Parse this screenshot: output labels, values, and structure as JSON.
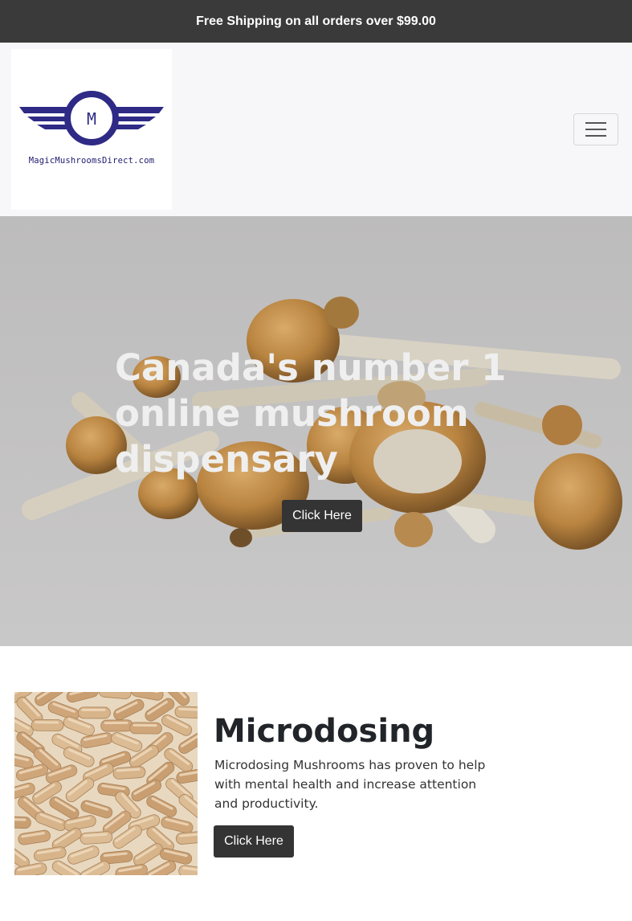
{
  "promo": {
    "text": "Free Shipping on all orders over $99.00"
  },
  "header": {
    "logo_letter": "M",
    "logo_text": "MagicMushroomsDirect.com",
    "menu_icon": "hamburger-menu-icon"
  },
  "hero": {
    "title": "Canada's number 1 online mushroom dispensary",
    "button_label": "Click Here"
  },
  "microdosing": {
    "title": "Microdosing",
    "description": "Microdosing Mushrooms has proven to help with mental health and increase attention and productivity.",
    "button_label": "Click Here"
  },
  "colors": {
    "promo_bg": "#3a3a3a",
    "navbar_bg": "#f7f7f9",
    "logo_blue": "#2e2a86",
    "button_bg": "#343434"
  }
}
